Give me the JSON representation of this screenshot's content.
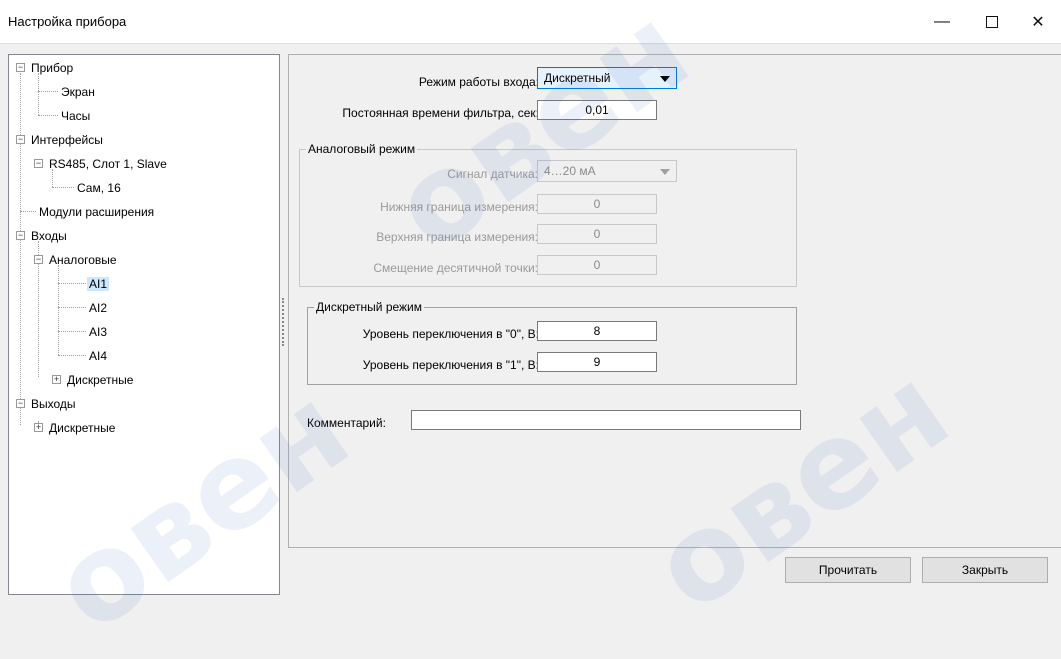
{
  "window": {
    "title": "Настройка прибора"
  },
  "tree": [
    {
      "label": "Прибор"
    },
    {
      "label": "Экран"
    },
    {
      "label": "Часы"
    },
    {
      "label": "Интерфейсы"
    },
    {
      "label": "RS485, Слот 1, Slave"
    },
    {
      "label": "Сам, 16"
    },
    {
      "label": "Модули расширения"
    },
    {
      "label": "Входы"
    },
    {
      "label": "Аналоговые"
    },
    {
      "label": "AI1"
    },
    {
      "label": "AI2"
    },
    {
      "label": "AI3"
    },
    {
      "label": "AI4"
    },
    {
      "label": "Дискретные"
    },
    {
      "label": "Выходы"
    },
    {
      "label": "Дискретные"
    }
  ],
  "form": {
    "mode_label": "Режим работы входа:",
    "mode_value": "Дискретный",
    "filter_label": "Постоянная времени фильтра, сек:",
    "filter_value": "0,01",
    "analog": {
      "title": "Аналоговый режим",
      "signal_label": "Сигнал датчика:",
      "signal_value": "4…20 мА",
      "low_label": "Нижняя граница измерения:",
      "low_value": "0",
      "high_label": "Верхняя граница измерения:",
      "high_value": "0",
      "dp_label": "Смещение десятичной точки:",
      "dp_value": "0"
    },
    "discrete": {
      "title": "Дискретный режим",
      "level0_label": "Уровень переключения в \"0\", В:",
      "level0_value": "8",
      "level1_label": "Уровень переключения в \"1\", В:",
      "level1_value": "9"
    },
    "comment_label": "Комментарий:",
    "comment_value": ""
  },
  "buttons": {
    "read": "Прочитать",
    "close": "Закрыть"
  },
  "watermark": {
    "text": "овен"
  }
}
